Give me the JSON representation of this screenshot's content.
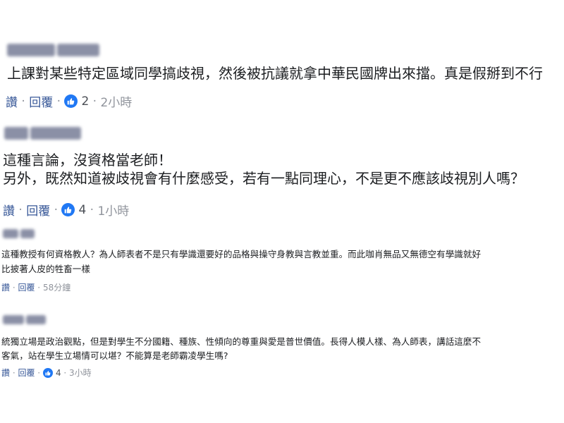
{
  "comments": [
    {
      "lines": [
        "上課對某些特定區域同學搞歧視，然後被抗議就拿中華民國牌出來擋。真是假掰到不行"
      ],
      "like_label": "讚",
      "reply_label": "回覆",
      "reactions": "2",
      "time": "2小時"
    },
    {
      "lines": [
        "這種言論，沒資格當老師！",
        "另外，既然知道被歧視會有什麼感受，若有一點同理心，不是更不應該歧視別人嗎？"
      ],
      "like_label": "讚",
      "reply_label": "回覆",
      "reactions": "4",
      "time": "1小時"
    },
    {
      "lines": [
        "這種教授有何資格教人？為人師表者不是只有學識還要好的品格與操守身教與言教並重。而此咖肖無品又無德空有學識就好",
        "比披著人皮的牲畜一樣"
      ],
      "like_label": "讚",
      "reply_label": "回覆",
      "reactions": "",
      "time": "58分鐘"
    },
    {
      "lines": [
        "統獨立場是政治觀點，但是對學生不分國籍、種族、性傾向的尊重與愛是普世價值。長得人模人樣、為人師表，講話這麼不",
        "客氣，站在學生立場情可以堪？不能算是老師霸凌學生嗎?"
      ],
      "like_label": "讚",
      "reply_label": "回覆",
      "reactions": "4",
      "time": "3小時"
    }
  ],
  "colors": {
    "link": "#385898",
    "meta": "#90949c",
    "like_icon_bg": "#2078f4",
    "blurred_name": "#8b90a6"
  },
  "icons": {
    "like": "thumbs-up-icon"
  }
}
